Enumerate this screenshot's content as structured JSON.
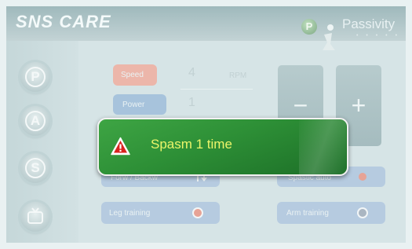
{
  "header": {
    "brand": "SNS CARE",
    "mode_title": "Passivity",
    "mode_logo_letter": "P",
    "mode_dots": "• • • • •"
  },
  "sidebar": {
    "items": [
      {
        "letter": "P",
        "icon": "mode-p-icon"
      },
      {
        "letter": "A",
        "icon": "mode-a-icon"
      },
      {
        "letter": "S",
        "icon": "mode-s-icon"
      },
      {
        "letter": "",
        "icon": "tv-icon"
      }
    ]
  },
  "controls": {
    "speed_label": "Speed",
    "speed_value": "4",
    "speed_unit": "RPM",
    "power_label": "Power",
    "power_value": "1",
    "minus": "−",
    "plus": "+",
    "direction_label": "Forw / Backw",
    "spastic_label": "Spastic auto",
    "leg_label": "Leg training",
    "arm_label": "Arm training"
  },
  "alert": {
    "message": "Spasm 1 time",
    "icon": "warning-icon"
  },
  "colors": {
    "toast": "#2d8f36",
    "toast_text": "#ecf56a",
    "speed_button": "#ecb6aa",
    "power_button": "#a7c3dc"
  }
}
